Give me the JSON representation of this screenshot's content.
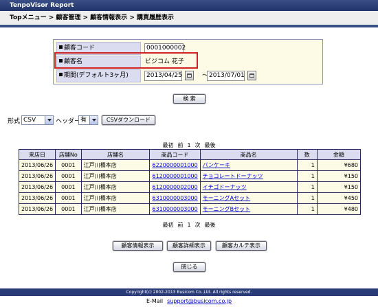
{
  "header": {
    "title": "TenpoVisor Report",
    "breadcrumb": "Topメニュー > 顧客管理 > 顧客情報表示 > 購買履歴表示"
  },
  "customer": {
    "code_label": "顧客コード",
    "code_value": "0001000002",
    "name_label": "顧客名",
    "name_value": "ビジコム 花子",
    "period_label": "期間(デフォルト3ヶ月)",
    "date_from": "2013/04/25",
    "date_to": "2013/07/01",
    "separator": "～"
  },
  "search_button": "検 索",
  "export": {
    "format_label": "形式",
    "format_value": "CSV",
    "header_label": "ヘッダー",
    "header_value": "有",
    "download_button": "CSVダウンロード"
  },
  "pager": {
    "first": "最初",
    "prev": "前",
    "page": "1",
    "next": "次",
    "last": "最後"
  },
  "table": {
    "columns": [
      "来店日",
      "店舗No",
      "店舗名",
      "商品コード",
      "商品名",
      "数",
      "金額"
    ],
    "rows": [
      {
        "date": "2013/06/26",
        "store_no": "0001",
        "store": "江戸川橋本店",
        "code": "6220000001000",
        "product": "パンケーキ",
        "qty": "1",
        "amount": "¥680"
      },
      {
        "date": "2013/06/26",
        "store_no": "0001",
        "store": "江戸川橋本店",
        "code": "6120000001000",
        "product": "チョコレートドーナッツ",
        "qty": "1",
        "amount": "¥150"
      },
      {
        "date": "2013/06/26",
        "store_no": "0001",
        "store": "江戸川橋本店",
        "code": "6120000002000",
        "product": "イチゴドーナッツ",
        "qty": "1",
        "amount": "¥150"
      },
      {
        "date": "2013/06/26",
        "store_no": "0001",
        "store": "江戸川橋本店",
        "code": "6310000003000",
        "product": "モーニングAセット",
        "qty": "1",
        "amount": "¥450"
      },
      {
        "date": "2013/06/26",
        "store_no": "0001",
        "store": "江戸川橋本店",
        "code": "6310000003000",
        "product": "モーニングBセット",
        "qty": "1",
        "amount": "¥480"
      }
    ]
  },
  "actions": {
    "customer_info": "顧客情報表示",
    "customer_detail": "顧客詳細表示",
    "customer_karte": "顧客カルテ表示",
    "close": "閉じる"
  },
  "footer": {
    "copyright": "Copyright(c) 2002-2013 Busicom Co.,Ltd. All rights reserved.",
    "email_label": "E-Mail",
    "email": "support@busicom.co.jp"
  },
  "colors": {
    "header_bg": "#3a4f86",
    "label_bg": "#dcdcf0",
    "value_bg": "#fdfbe5",
    "highlight": "#d22222"
  }
}
